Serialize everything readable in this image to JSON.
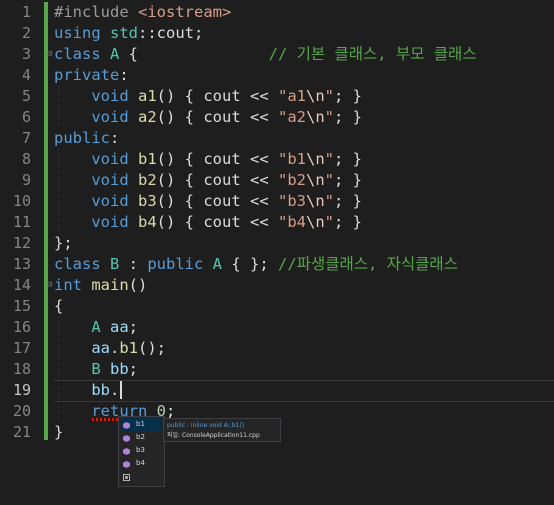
{
  "editor": {
    "current_line": 19,
    "lines": [
      {
        "n": "1",
        "tokens": [
          {
            "t": "#include ",
            "c": "pp"
          },
          {
            "t": "<iostream>",
            "c": "st"
          }
        ]
      },
      {
        "n": "2",
        "tokens": [
          {
            "t": "using ",
            "c": "kw"
          },
          {
            "t": "std",
            "c": "ty"
          },
          {
            "t": "::",
            "c": ""
          },
          {
            "t": "cout",
            "c": ""
          },
          {
            "t": ";",
            "c": ""
          }
        ]
      },
      {
        "n": "3",
        "fold": "⊟",
        "tokens": [
          {
            "t": "class ",
            "c": "kw"
          },
          {
            "t": "A",
            "c": "ty"
          },
          {
            "t": " {              ",
            "c": ""
          },
          {
            "t": "// 기본 클래스, 부모 클래스",
            "c": "cm"
          }
        ]
      },
      {
        "n": "4",
        "tokens": [
          {
            "t": "private",
            "c": "kw"
          },
          {
            "t": ":",
            "c": ""
          }
        ]
      },
      {
        "n": "5",
        "tokens": [
          {
            "t": "    ",
            "c": ""
          },
          {
            "t": "void ",
            "c": "kw"
          },
          {
            "t": "a1",
            "c": "fn"
          },
          {
            "t": "() { ",
            "c": ""
          },
          {
            "t": "cout",
            "c": ""
          },
          {
            "t": " << ",
            "c": ""
          },
          {
            "t": "\"a1",
            "c": "st"
          },
          {
            "t": "\\n",
            "c": "es"
          },
          {
            "t": "\"",
            "c": "st"
          },
          {
            "t": "; }",
            "c": ""
          }
        ]
      },
      {
        "n": "6",
        "tokens": [
          {
            "t": "    ",
            "c": ""
          },
          {
            "t": "void ",
            "c": "kw"
          },
          {
            "t": "a2",
            "c": "fn"
          },
          {
            "t": "() { ",
            "c": ""
          },
          {
            "t": "cout",
            "c": ""
          },
          {
            "t": " << ",
            "c": ""
          },
          {
            "t": "\"a2",
            "c": "st"
          },
          {
            "t": "\\n",
            "c": "es"
          },
          {
            "t": "\"",
            "c": "st"
          },
          {
            "t": "; }",
            "c": ""
          }
        ]
      },
      {
        "n": "7",
        "tokens": [
          {
            "t": "public",
            "c": "kw"
          },
          {
            "t": ":",
            "c": ""
          }
        ]
      },
      {
        "n": "8",
        "tokens": [
          {
            "t": "    ",
            "c": ""
          },
          {
            "t": "void ",
            "c": "kw"
          },
          {
            "t": "b1",
            "c": "fn"
          },
          {
            "t": "() { ",
            "c": ""
          },
          {
            "t": "cout",
            "c": ""
          },
          {
            "t": " << ",
            "c": ""
          },
          {
            "t": "\"b1",
            "c": "st"
          },
          {
            "t": "\\n",
            "c": "es"
          },
          {
            "t": "\"",
            "c": "st"
          },
          {
            "t": "; }",
            "c": ""
          }
        ]
      },
      {
        "n": "9",
        "tokens": [
          {
            "t": "    ",
            "c": ""
          },
          {
            "t": "void ",
            "c": "kw"
          },
          {
            "t": "b2",
            "c": "fn"
          },
          {
            "t": "() { ",
            "c": ""
          },
          {
            "t": "cout",
            "c": ""
          },
          {
            "t": " << ",
            "c": ""
          },
          {
            "t": "\"b2",
            "c": "st"
          },
          {
            "t": "\\n",
            "c": "es"
          },
          {
            "t": "\"",
            "c": "st"
          },
          {
            "t": "; }",
            "c": ""
          }
        ]
      },
      {
        "n": "10",
        "tokens": [
          {
            "t": "    ",
            "c": ""
          },
          {
            "t": "void ",
            "c": "kw"
          },
          {
            "t": "b3",
            "c": "fn"
          },
          {
            "t": "() { ",
            "c": ""
          },
          {
            "t": "cout",
            "c": ""
          },
          {
            "t": " << ",
            "c": ""
          },
          {
            "t": "\"b3",
            "c": "st"
          },
          {
            "t": "\\n",
            "c": "es"
          },
          {
            "t": "\"",
            "c": "st"
          },
          {
            "t": "; }",
            "c": ""
          }
        ]
      },
      {
        "n": "11",
        "tokens": [
          {
            "t": "    ",
            "c": ""
          },
          {
            "t": "void ",
            "c": "kw"
          },
          {
            "t": "b4",
            "c": "fn"
          },
          {
            "t": "() { ",
            "c": ""
          },
          {
            "t": "cout",
            "c": ""
          },
          {
            "t": " << ",
            "c": ""
          },
          {
            "t": "\"b4",
            "c": "st"
          },
          {
            "t": "\\n",
            "c": "es"
          },
          {
            "t": "\"",
            "c": "st"
          },
          {
            "t": "; }",
            "c": ""
          }
        ]
      },
      {
        "n": "12",
        "tokens": [
          {
            "t": "};",
            "c": ""
          }
        ]
      },
      {
        "n": "13",
        "tokens": [
          {
            "t": "class ",
            "c": "kw"
          },
          {
            "t": "B",
            "c": "ty"
          },
          {
            "t": " : ",
            "c": ""
          },
          {
            "t": "public ",
            "c": "kw"
          },
          {
            "t": "A",
            "c": "ty"
          },
          {
            "t": " { }; ",
            "c": ""
          },
          {
            "t": "//파생클래스, 자식클래스",
            "c": "cm"
          }
        ]
      },
      {
        "n": "14",
        "fold": "⊟",
        "tokens": [
          {
            "t": "int ",
            "c": "kw"
          },
          {
            "t": "main",
            "c": "fn"
          },
          {
            "t": "()",
            "c": ""
          }
        ]
      },
      {
        "n": "15",
        "tokens": [
          {
            "t": "{",
            "c": ""
          }
        ]
      },
      {
        "n": "16",
        "tokens": [
          {
            "t": "    ",
            "c": ""
          },
          {
            "t": "A ",
            "c": "ty"
          },
          {
            "t": "aa",
            "c": "var"
          },
          {
            "t": ";",
            "c": ""
          }
        ]
      },
      {
        "n": "17",
        "tokens": [
          {
            "t": "    ",
            "c": ""
          },
          {
            "t": "aa",
            "c": "var"
          },
          {
            "t": ".",
            "c": ""
          },
          {
            "t": "b1",
            "c": "fn"
          },
          {
            "t": "();",
            "c": ""
          }
        ]
      },
      {
        "n": "18",
        "tokens": [
          {
            "t": "    ",
            "c": ""
          },
          {
            "t": "B ",
            "c": "ty"
          },
          {
            "t": "bb",
            "c": "var"
          },
          {
            "t": ";",
            "c": ""
          }
        ]
      },
      {
        "n": "19",
        "tokens": [
          {
            "t": "    ",
            "c": ""
          },
          {
            "t": "bb",
            "c": "var"
          },
          {
            "t": ".",
            "c": ""
          }
        ]
      },
      {
        "n": "20",
        "tokens": [
          {
            "t": "    ",
            "c": ""
          },
          {
            "t": "return ",
            "c": "kw"
          },
          {
            "t": "0",
            "c": "nu"
          },
          {
            "t": ";",
            "c": ""
          }
        ]
      },
      {
        "n": "21",
        "tokens": [
          {
            "t": "}",
            "c": ""
          }
        ]
      }
    ]
  },
  "intellisense": {
    "items": [
      {
        "label": "b1",
        "icon": "method-icon",
        "selected": true
      },
      {
        "label": "b2",
        "icon": "method-icon"
      },
      {
        "label": "b3",
        "icon": "method-icon"
      },
      {
        "label": "b4",
        "icon": "method-icon"
      },
      {
        "label": "",
        "icon": "snippet-icon"
      }
    ],
    "tooltip": {
      "signature": "public : inline void A::b1()",
      "file": "파일: ConsoleApplication11.cpp"
    }
  },
  "colors": {
    "background": "#1e1e1e",
    "keyword": "#569cd6",
    "type": "#4ec9b0",
    "function": "#dcdcaa",
    "string": "#d69d85",
    "comment": "#57a64a",
    "change_bar": "#57a64a",
    "method_icon": "#b180d7"
  }
}
